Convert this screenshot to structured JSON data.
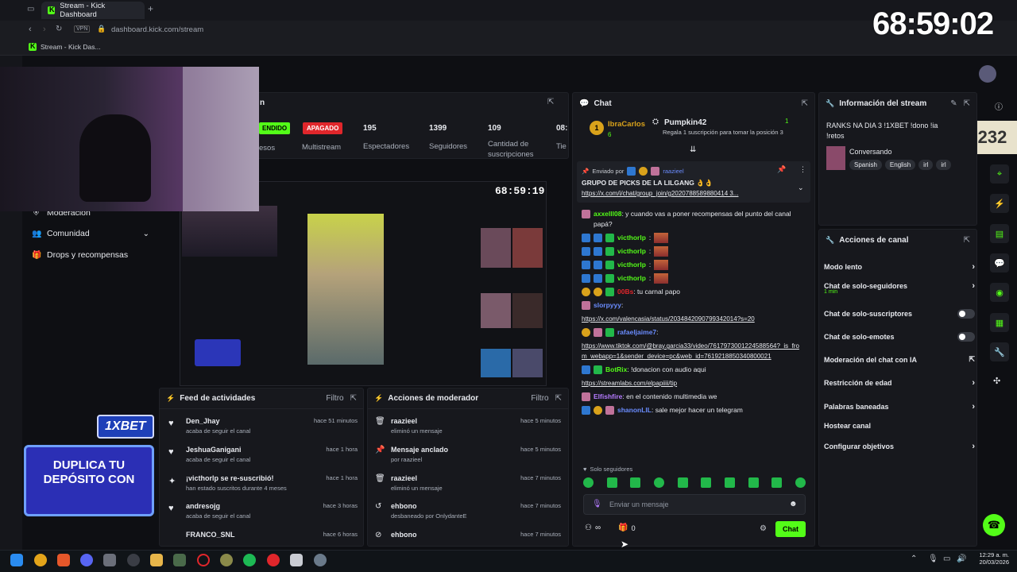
{
  "browser": {
    "tab_title": "Stream - Kick Dashboard",
    "url": "dashboard.kick.com/stream",
    "vpn": "VPN",
    "bookmark": "Stream - Kick Das..."
  },
  "overlay_timer": "68:59:02",
  "viewer_badge": "232",
  "preview_timer": "68:59:19",
  "sidebar": {
    "items": [
      {
        "label": "Moderación"
      },
      {
        "label": "Comunidad"
      },
      {
        "label": "Drops y recompensas"
      }
    ]
  },
  "stream_header": {
    "title_fragment": "n",
    "status_on": "ENDIDO",
    "status_off": "APAGADO",
    "partial_label_1": "esos",
    "multistream": "Multistream",
    "stats": [
      {
        "value": "195",
        "label": "Espectadores"
      },
      {
        "value": "1399",
        "label": "Seguidores"
      },
      {
        "value": "109",
        "label": "Cantidad de suscripciones"
      },
      {
        "value": "08:",
        "label": "Tie"
      }
    ]
  },
  "chat": {
    "title": "Chat",
    "top_gifter": {
      "name": "IbraCarlos",
      "count": "6"
    },
    "goal": {
      "name": "Pumpkin42",
      "text": "Regala 1 suscripción para tomar la posición 3",
      "count": "1"
    },
    "pinned": {
      "sent_by_label": "Enviado por",
      "sent_by_user": "raazieel",
      "message": "GRUPO DE PICKS DE LA LILGANG 👌👌",
      "link": "https://x.com/i/chat/group_join/g2020788589880414 3..."
    },
    "messages": [
      {
        "user": "axxelll08",
        "text": ": y cuando vas a poner recompensas del punto del canal papá?"
      },
      {
        "user": "victhorlp",
        "text": ":"
      },
      {
        "user": "victhorlp",
        "text": ":"
      },
      {
        "user": "victhorlp",
        "text": ":"
      },
      {
        "user": "victhorlp",
        "text": ":"
      },
      {
        "user": "00Bs",
        "text": ": tu carnal papo"
      },
      {
        "user": "slorpyyy",
        "text": ":",
        "link": "https://x.com/valencasia/status/2034842090799342014?s=20"
      },
      {
        "user": "rafaeljaime7",
        "text": ":",
        "link": "https://www.tiktok.com/@bray.garcia33/video/7617973001224588564?_is_from_webapp=1&sender_device=pc&web_id=7619218850340800021"
      },
      {
        "user": "BotRix",
        "text": ": !donacion con audio aqui",
        "link": "https://streamlabs.com/elpapiiii/tip"
      },
      {
        "user": "Elfishfire",
        "text": ": en el contenido multimedia we"
      },
      {
        "user": "shanonLIL",
        "text": ": sale mejor hacer un telegram"
      }
    ],
    "followers_only": "Solo seguidores",
    "input_placeholder": "Enviar un mensaje",
    "infinity": "∞",
    "count": "0",
    "send_label": "Chat"
  },
  "stream_info": {
    "title": "Información del stream",
    "stream_title": "RANKS NA DIA 3 !1XBET !dono !ia !retos",
    "category": "Conversando",
    "tags": [
      "Spanish",
      "English",
      "irl",
      "irl"
    ]
  },
  "channel_actions": {
    "title": "Acciones de canal",
    "items": [
      {
        "label": "Modo lento",
        "kind": "chevron"
      },
      {
        "label": "Chat de solo-seguidores",
        "sub": "1 min",
        "kind": "chevron"
      },
      {
        "label": "Chat de solo-suscriptores",
        "kind": "toggle"
      },
      {
        "label": "Chat de solo-emotes",
        "kind": "toggle"
      },
      {
        "label": "Moderación del chat con IA",
        "kind": "external"
      },
      {
        "label": "Restricción de edad",
        "kind": "chevron"
      },
      {
        "label": "Palabras baneadas",
        "kind": "chevron"
      },
      {
        "label": "Hostear canal",
        "kind": "none"
      },
      {
        "label": "Configurar objetivos",
        "kind": "chevron"
      }
    ]
  },
  "activity_feed": {
    "title": "Feed de actividades",
    "filter": "Filtro",
    "items": [
      {
        "name": "Den_Jhay",
        "sub": "acaba de seguir el canal",
        "time": "hace 51 minutos"
      },
      {
        "name": "JeshuaGanigani",
        "sub": "acaba de seguir el canal",
        "time": "hace 1 hora"
      },
      {
        "name": "¡victhorlp se re-suscribió!",
        "sub": "han estado suscritos durante 4 meses",
        "time": "hace 1 hora"
      },
      {
        "name": "andresojg",
        "sub": "acaba de seguir el canal",
        "time": "hace 3 horas"
      },
      {
        "name": "FRANCO_SNL",
        "sub": "",
        "time": "hace 6 horas"
      }
    ]
  },
  "mod_actions": {
    "title": "Acciones de moderador",
    "filter": "Filtro",
    "items": [
      {
        "name": "raazieel",
        "sub": "eliminó un mensaje",
        "time": "hace 5 minutos"
      },
      {
        "name": "Mensaje anclado",
        "sub": "por raazieel",
        "time": "hace 5 minutos"
      },
      {
        "name": "raazieel",
        "sub": "eliminó un mensaje",
        "time": "hace 7 minutos"
      },
      {
        "name": "ehbono",
        "sub": "desbaneado por OnlydanteE",
        "time": "hace 7 minutos"
      },
      {
        "name": "ehbono",
        "sub": "",
        "time": "hace 7 minutos"
      }
    ]
  },
  "promo": {
    "brand": "1XBET",
    "line1": "DUPLICA TU",
    "line2": "DEPÓSITO CON"
  },
  "taskbar": {
    "time": "12:29 a. m.",
    "date": "20/03/2026"
  },
  "colors": {
    "accent": "#53fc18",
    "danger": "#e0262b",
    "bg": "#0e0f13"
  }
}
